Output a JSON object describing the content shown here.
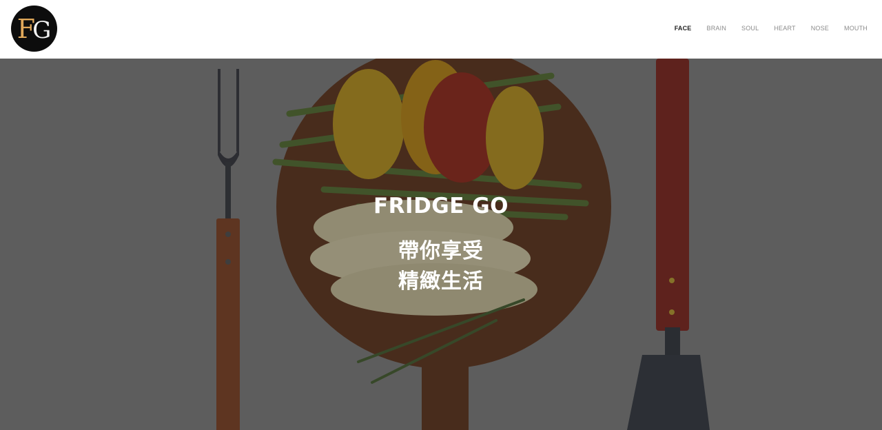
{
  "brand": {
    "logo_f": "F",
    "logo_g": "G",
    "colors": {
      "logo_bg": "#0d0d0d",
      "logo_f": "#e0a85a",
      "logo_g": "#f2f2f2"
    }
  },
  "nav": {
    "items": [
      {
        "label": "FACE",
        "active": true
      },
      {
        "label": "BRAIN",
        "active": false
      },
      {
        "label": "SOUL",
        "active": false
      },
      {
        "label": "HEART",
        "active": false
      },
      {
        "label": "NOSE",
        "active": false
      },
      {
        "label": "MOUTH",
        "active": false
      }
    ]
  },
  "hero": {
    "title": "FRIDGE GO",
    "subtitle_line1": "帶你享受",
    "subtitle_line2": "精緻生活"
  }
}
